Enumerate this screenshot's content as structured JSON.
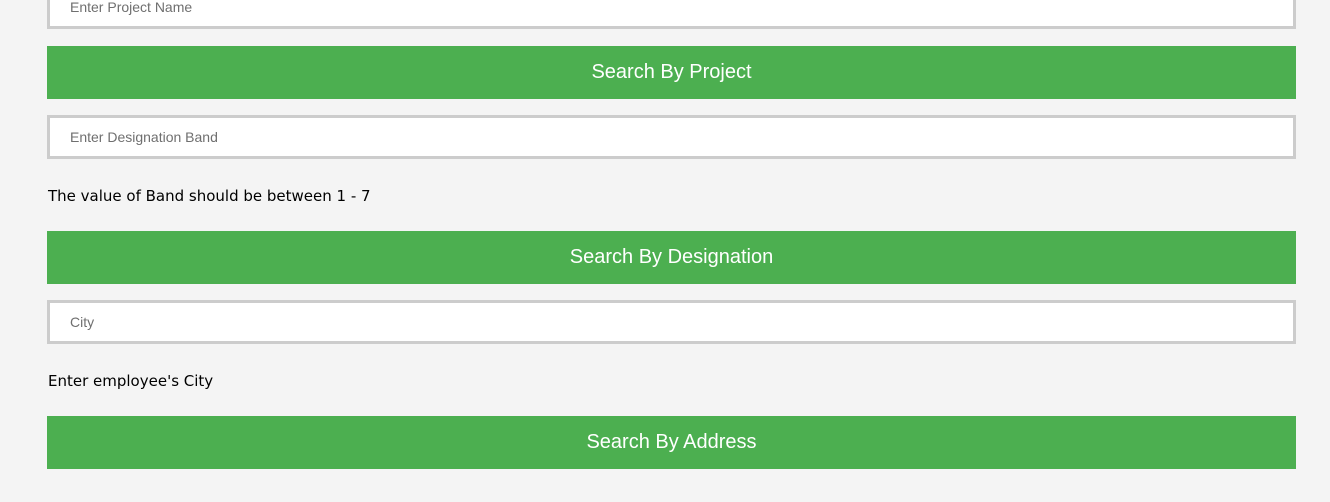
{
  "project_search": {
    "input_placeholder": "Enter Project Name",
    "button_label": "Search By Project"
  },
  "designation_search": {
    "input_placeholder": "Enter Designation Band",
    "hint": "The value of Band should be between 1 - 7",
    "button_label": "Search By Designation"
  },
  "address_search": {
    "input_placeholder": "City",
    "hint": "Enter employee's City",
    "button_label": "Search By Address"
  },
  "colors": {
    "button_background": "#4caf50",
    "button_text": "#ffffff",
    "page_background": "#f4f4f4",
    "field_border": "#cccccc"
  }
}
